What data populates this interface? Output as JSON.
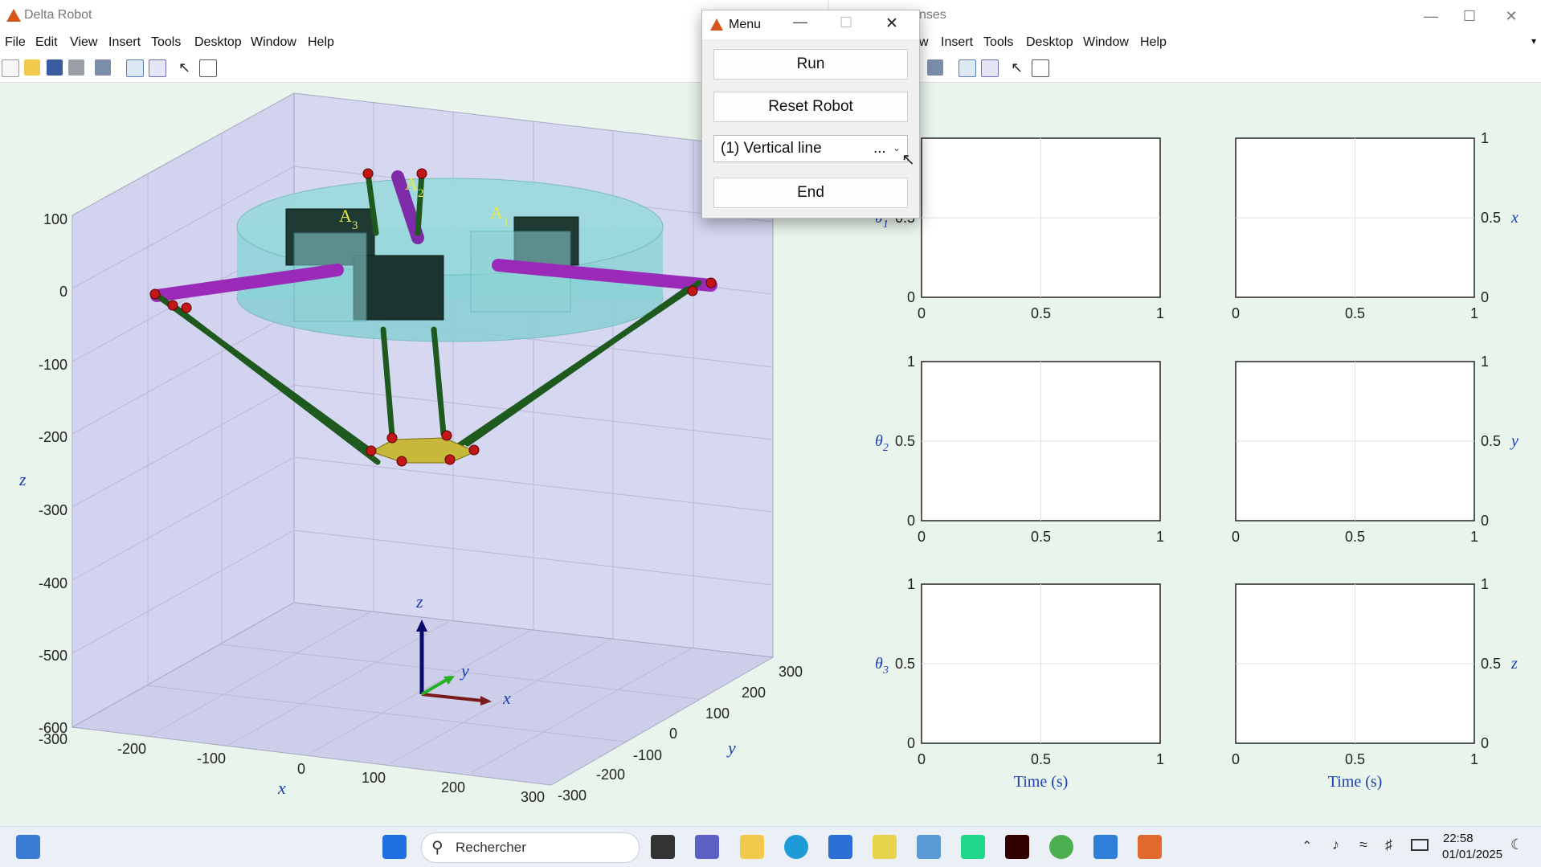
{
  "left_window": {
    "title": "Delta Robot",
    "menu": [
      "File",
      "Edit",
      "View",
      "Insert",
      "Tools",
      "Desktop",
      "Window",
      "Help"
    ],
    "plot": {
      "z_ticks": [
        "100",
        "0",
        "-100",
        "-200",
        "-300",
        "-400",
        "-500",
        "-600"
      ],
      "x_ticks": [
        "-300",
        "-200",
        "-100",
        "0",
        "100",
        "200",
        "300"
      ],
      "y_ticks": [
        "-300",
        "-200",
        "-100",
        "0",
        "100",
        "200",
        "300"
      ],
      "xlabel": "x",
      "ylabel": "y",
      "zlabel": "z",
      "frame_labels": {
        "z": "z",
        "y": "y",
        "x": "x"
      },
      "arm_labels": [
        "A",
        "3",
        "A",
        "2",
        "A",
        "1"
      ]
    }
  },
  "right_window": {
    "title_fragment": "nses",
    "menu": [
      "w",
      "Insert",
      "Tools",
      "Desktop",
      "Window",
      "Help"
    ],
    "plots": {
      "left_labels": [
        "θ1",
        "θ2",
        "θ3"
      ],
      "theta_sym": "θ",
      "theta_subs": [
        "1",
        "2",
        "3"
      ],
      "right_labels": [
        "x",
        "y",
        "z"
      ],
      "yticks": [
        "0",
        "0.5",
        "1"
      ],
      "xticks": [
        "0",
        "0.5",
        "1"
      ],
      "xlabel": "Time (s)"
    }
  },
  "dialog": {
    "title": "Menu",
    "run_label": "Run",
    "reset_label": "Reset Robot",
    "select_value": "(1) Vertical line",
    "select_more": "...",
    "end_label": "End"
  },
  "taskbar": {
    "search_placeholder": "Rechercher",
    "time": "22:58",
    "date": "01/01/2025"
  },
  "colors": {
    "axes_bg": "#d2d3ef",
    "arm_purple": "#9b2ab8",
    "rod_green": "#1e5a1e",
    "platform_cyan": "#7ad2d4",
    "label_blue": "#1a3fb0"
  }
}
